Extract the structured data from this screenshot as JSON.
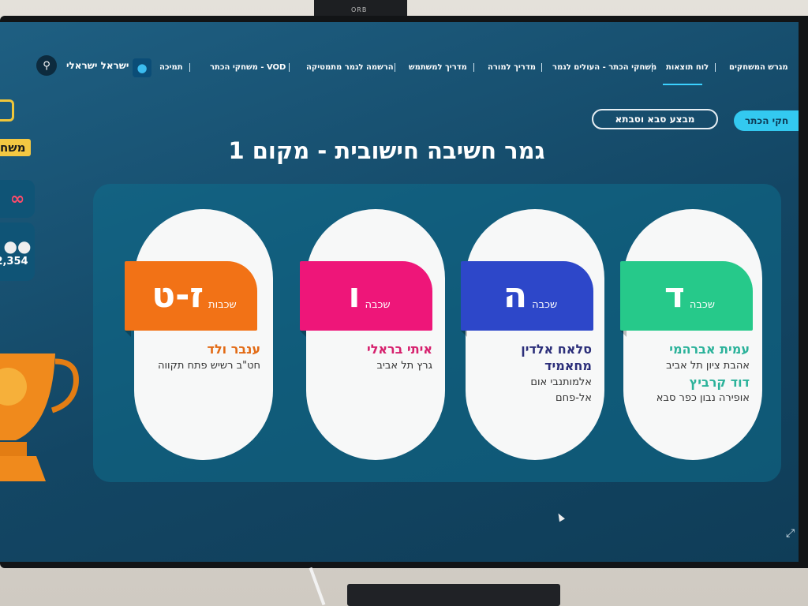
{
  "device": {
    "camera_label": "ORB"
  },
  "nav": {
    "user_name": "ישראל ישראלי",
    "items": [
      {
        "label": "תמיכה"
      },
      {
        "label": "משחקי הכתר - VOD"
      },
      {
        "label": "הרשמה לגמר מתמטיקה"
      },
      {
        "label": "מדריך למשתמש"
      },
      {
        "label": "מדריך למורה"
      },
      {
        "label": "משחקי הכתר - העולים לגמר"
      },
      {
        "label": "לוח תוצאות"
      },
      {
        "label": "מגרש המשחקים"
      }
    ],
    "active_item": "לוח תוצאות"
  },
  "buttons": {
    "grandparents": "מבצע סבא וסבתא",
    "crown_games": "חקי הכתר"
  },
  "sidebar": {
    "brand": "משח",
    "stats_value": "2,354"
  },
  "page": {
    "title": "גמר חשיבה חישובית - מקום 1"
  },
  "cards": [
    {
      "grade_word": "שכבה",
      "grade_letter": "ד",
      "color": "#26c98a",
      "winners": [
        {
          "name": "עמית אברהמי",
          "school": "אהבת ציון תל אביב",
          "name_color": "#2bb29a"
        },
        {
          "name": "דוד קרביץ",
          "school": "אופירה נבון כפר סבא",
          "name_color": "#2bb29a"
        }
      ]
    },
    {
      "grade_word": "שכבה",
      "grade_letter": "ה",
      "color": "#2d47c9",
      "winners": [
        {
          "name": "סלאח אלדין מחאמיד",
          "school": "אלמותנבי אום אל-פחם",
          "name_color": "#2c2f7a"
        }
      ]
    },
    {
      "grade_word": "שכבה",
      "grade_letter": "ו",
      "color": "#ee1679",
      "winners": [
        {
          "name": "איתי בראלי",
          "school": "גרץ תל אביב",
          "name_color": "#d6206d"
        }
      ]
    },
    {
      "grade_word": "שכבות",
      "grade_letter": "ז-ט",
      "color": "#f27216",
      "winners": [
        {
          "name": "ענבר ולד",
          "school": "חט\"ב רשיש פתח תקווה",
          "name_color": "#e26a14"
        }
      ]
    }
  ]
}
